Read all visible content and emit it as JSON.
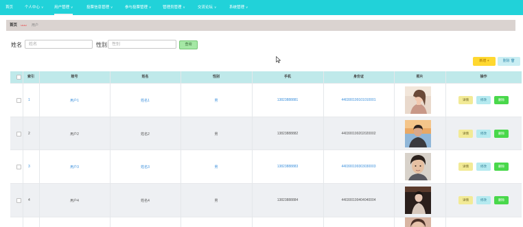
{
  "nav": {
    "items": [
      {
        "label": "首页",
        "chevron": false
      },
      {
        "label": "个人中心",
        "chevron": true
      },
      {
        "label": "用户管理",
        "chevron": true
      },
      {
        "label": "投票信息管理",
        "chevron": true
      },
      {
        "label": "参与投票管理",
        "chevron": true
      },
      {
        "label": "管理员管理",
        "chevron": true
      },
      {
        "label": "交流论坛",
        "chevron": true
      },
      {
        "label": "系统管理",
        "chevron": true
      }
    ]
  },
  "breadcrumb": {
    "home": "首页",
    "separator": "ᴗᴗᴗ",
    "current": "用户"
  },
  "search": {
    "name_label": "姓名",
    "name_placeholder": "姓名",
    "gender_label": "性别",
    "gender_placeholder": "性别",
    "search_button": "查询"
  },
  "actions": {
    "add": "新增 +",
    "delete": "删除 🗑"
  },
  "table": {
    "headers": {
      "index": "索引",
      "account": "账号",
      "name": "姓名",
      "gender": "性别",
      "phone": "手机",
      "idcard": "身份证",
      "photo": "照片",
      "ops": "操作"
    },
    "row_actions": {
      "detail": "详情",
      "edit": "修改",
      "delete": "删除"
    },
    "rows": [
      {
        "index": "1",
        "account": "用户1",
        "name": "姓名1",
        "gender": "男",
        "phone": "13823888881",
        "idcard": "440300199101010001"
      },
      {
        "index": "2",
        "account": "用户2",
        "name": "姓名2",
        "gender": "男",
        "phone": "13823888882",
        "idcard": "440300199202020002"
      },
      {
        "index": "3",
        "account": "用户3",
        "name": "姓名3",
        "gender": "男",
        "phone": "13823888883",
        "idcard": "440300199303030003"
      },
      {
        "index": "4",
        "account": "用户4",
        "name": "姓名4",
        "gender": "男",
        "phone": "13823888884",
        "idcard": "440300199404040004"
      }
    ]
  },
  "colors": {
    "nav_bg": "#21d2d9",
    "breadcrumb_bg": "#dad3d0",
    "header_bg": "#bfe9ea",
    "accent_link": "#3a8fdc"
  }
}
